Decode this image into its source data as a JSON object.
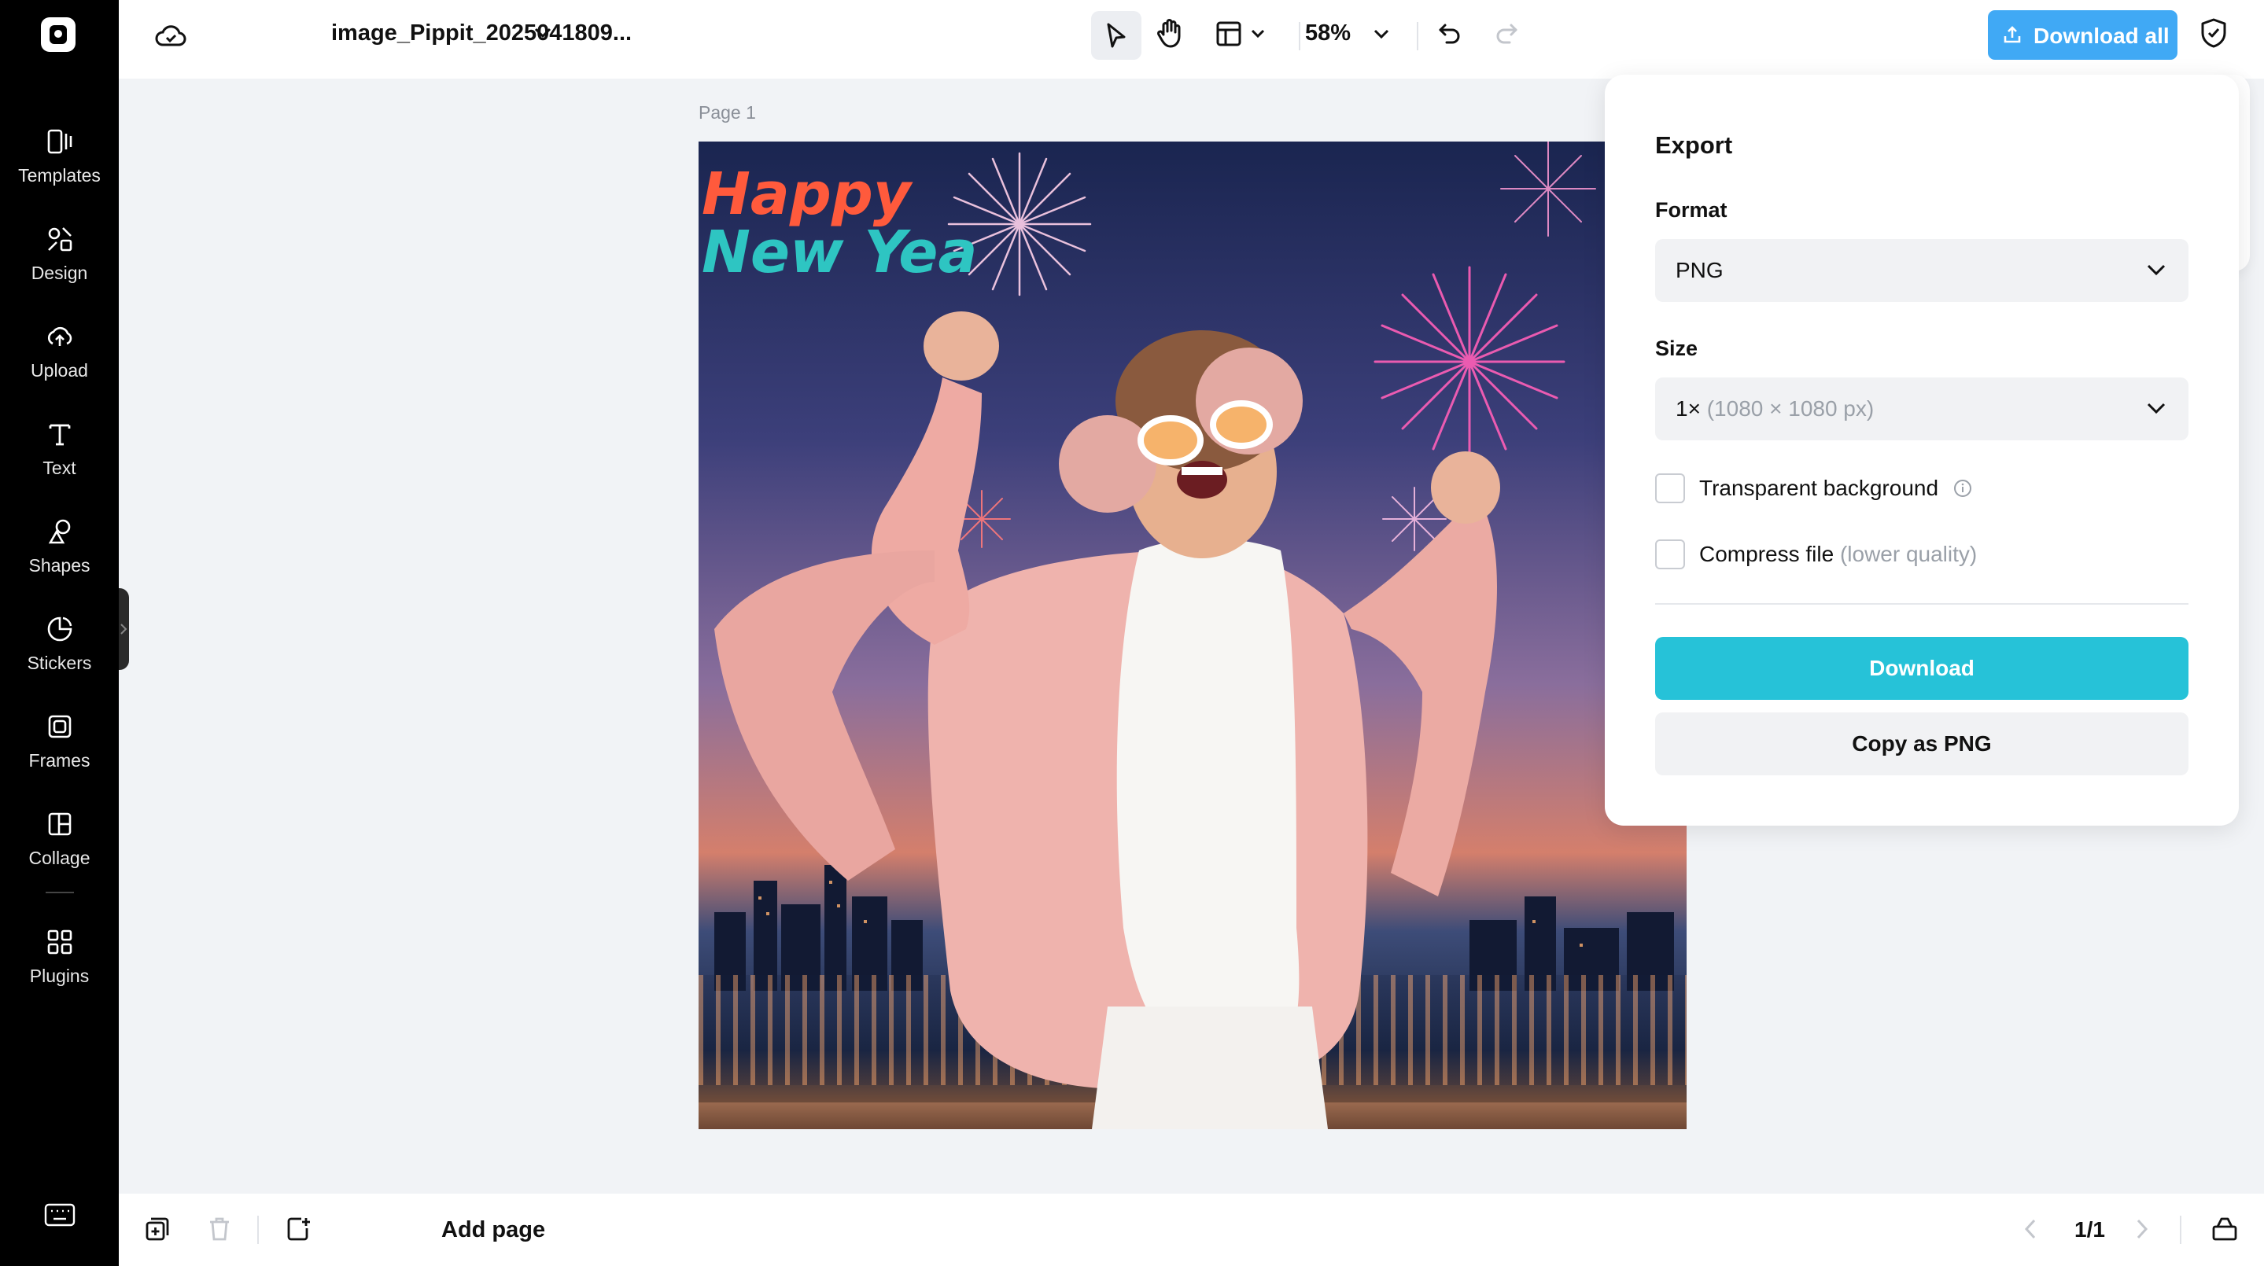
{
  "sidebar": {
    "items": [
      {
        "label": "Templates",
        "icon": "templates-icon"
      },
      {
        "label": "Design",
        "icon": "design-icon"
      },
      {
        "label": "Upload",
        "icon": "upload-icon"
      },
      {
        "label": "Text",
        "icon": "text-icon"
      },
      {
        "label": "Shapes",
        "icon": "shapes-icon"
      },
      {
        "label": "Stickers",
        "icon": "stickers-icon"
      },
      {
        "label": "Frames",
        "icon": "frames-icon"
      },
      {
        "label": "Collage",
        "icon": "collage-icon"
      },
      {
        "label": "Plugins",
        "icon": "plugins-icon"
      }
    ]
  },
  "header": {
    "filename": "image_Pippit_2025041809...",
    "zoom": "58%",
    "download_all_label": "Download all"
  },
  "canvas": {
    "page_label": "Page 1",
    "artwork_text_line1": "Happy",
    "artwork_text_line2": "New Yea"
  },
  "export_panel": {
    "title": "Export",
    "format_label": "Format",
    "format_value": "PNG",
    "size_label": "Size",
    "size_scale": "1×",
    "size_dims": "(1080 × 1080 px)",
    "transparent_label": "Transparent background",
    "compress_label": "Compress file",
    "compress_hint": "(lower quality)",
    "download_button": "Download",
    "copy_button": "Copy as PNG"
  },
  "footer": {
    "add_page_label": "Add page",
    "pager": "1/1"
  },
  "colors": {
    "accent_download": "#26c2d8",
    "download_all_bg": "#40a9f5",
    "rail_bg": "#000000"
  }
}
